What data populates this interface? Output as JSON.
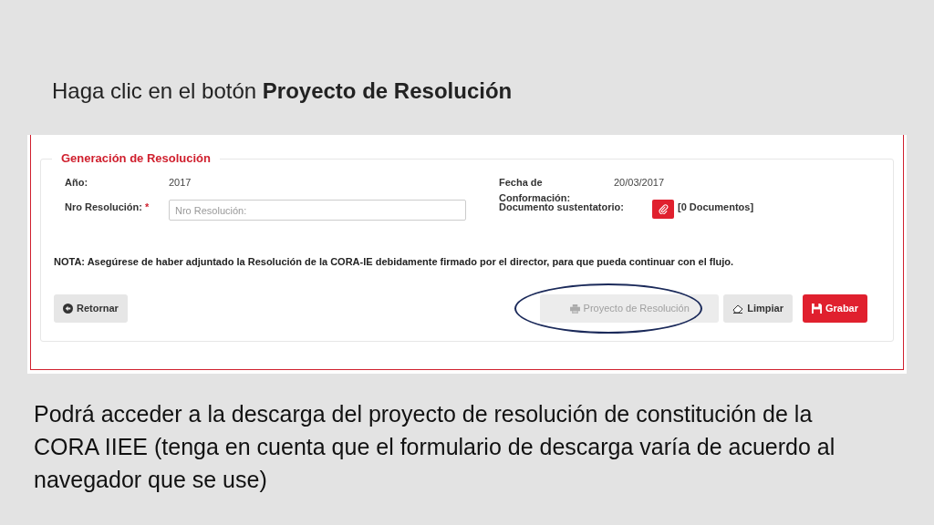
{
  "instruction": "Haga clic en el botón **Proyecto de Resolución**",
  "panel": {
    "title": "Generación de Resolución",
    "fields": [
      {
        "label": "Año:",
        "value": "2017"
      },
      {
        "label": "Fecha de Conformación:",
        "value": "20/03/2017"
      },
      {
        "label": "Nro Resolución:",
        "required_mark": "*",
        "placeholder": "Nro Resolución:"
      },
      {
        "label": "Documento sustentatorio:",
        "documents": "[0 Documentos]"
      }
    ],
    "note": "NOTA: Asegúrese de haber adjuntado la Resolución de la CORA-IE debidamente firmado por el director, para que pueda continuar con el flujo."
  },
  "buttons": [
    {
      "label": "Retornar",
      "kind": "back",
      "disabled": false,
      "highlighted": false
    },
    {
      "label": "Proyecto de Resolución",
      "kind": "print",
      "disabled": true,
      "highlighted": true
    },
    {
      "label": "Limpiar",
      "kind": "clear",
      "disabled": false,
      "highlighted": false
    },
    {
      "label": "Grabar",
      "kind": "save",
      "disabled": false,
      "highlighted": false
    }
  ],
  "caption": "Podrá acceder a la descarga del proyecto de resolución de constitución de la CORA IIEE (tenga en cuenta que el formulario de descarga varía de acuerdo al navegador que se use)"
}
